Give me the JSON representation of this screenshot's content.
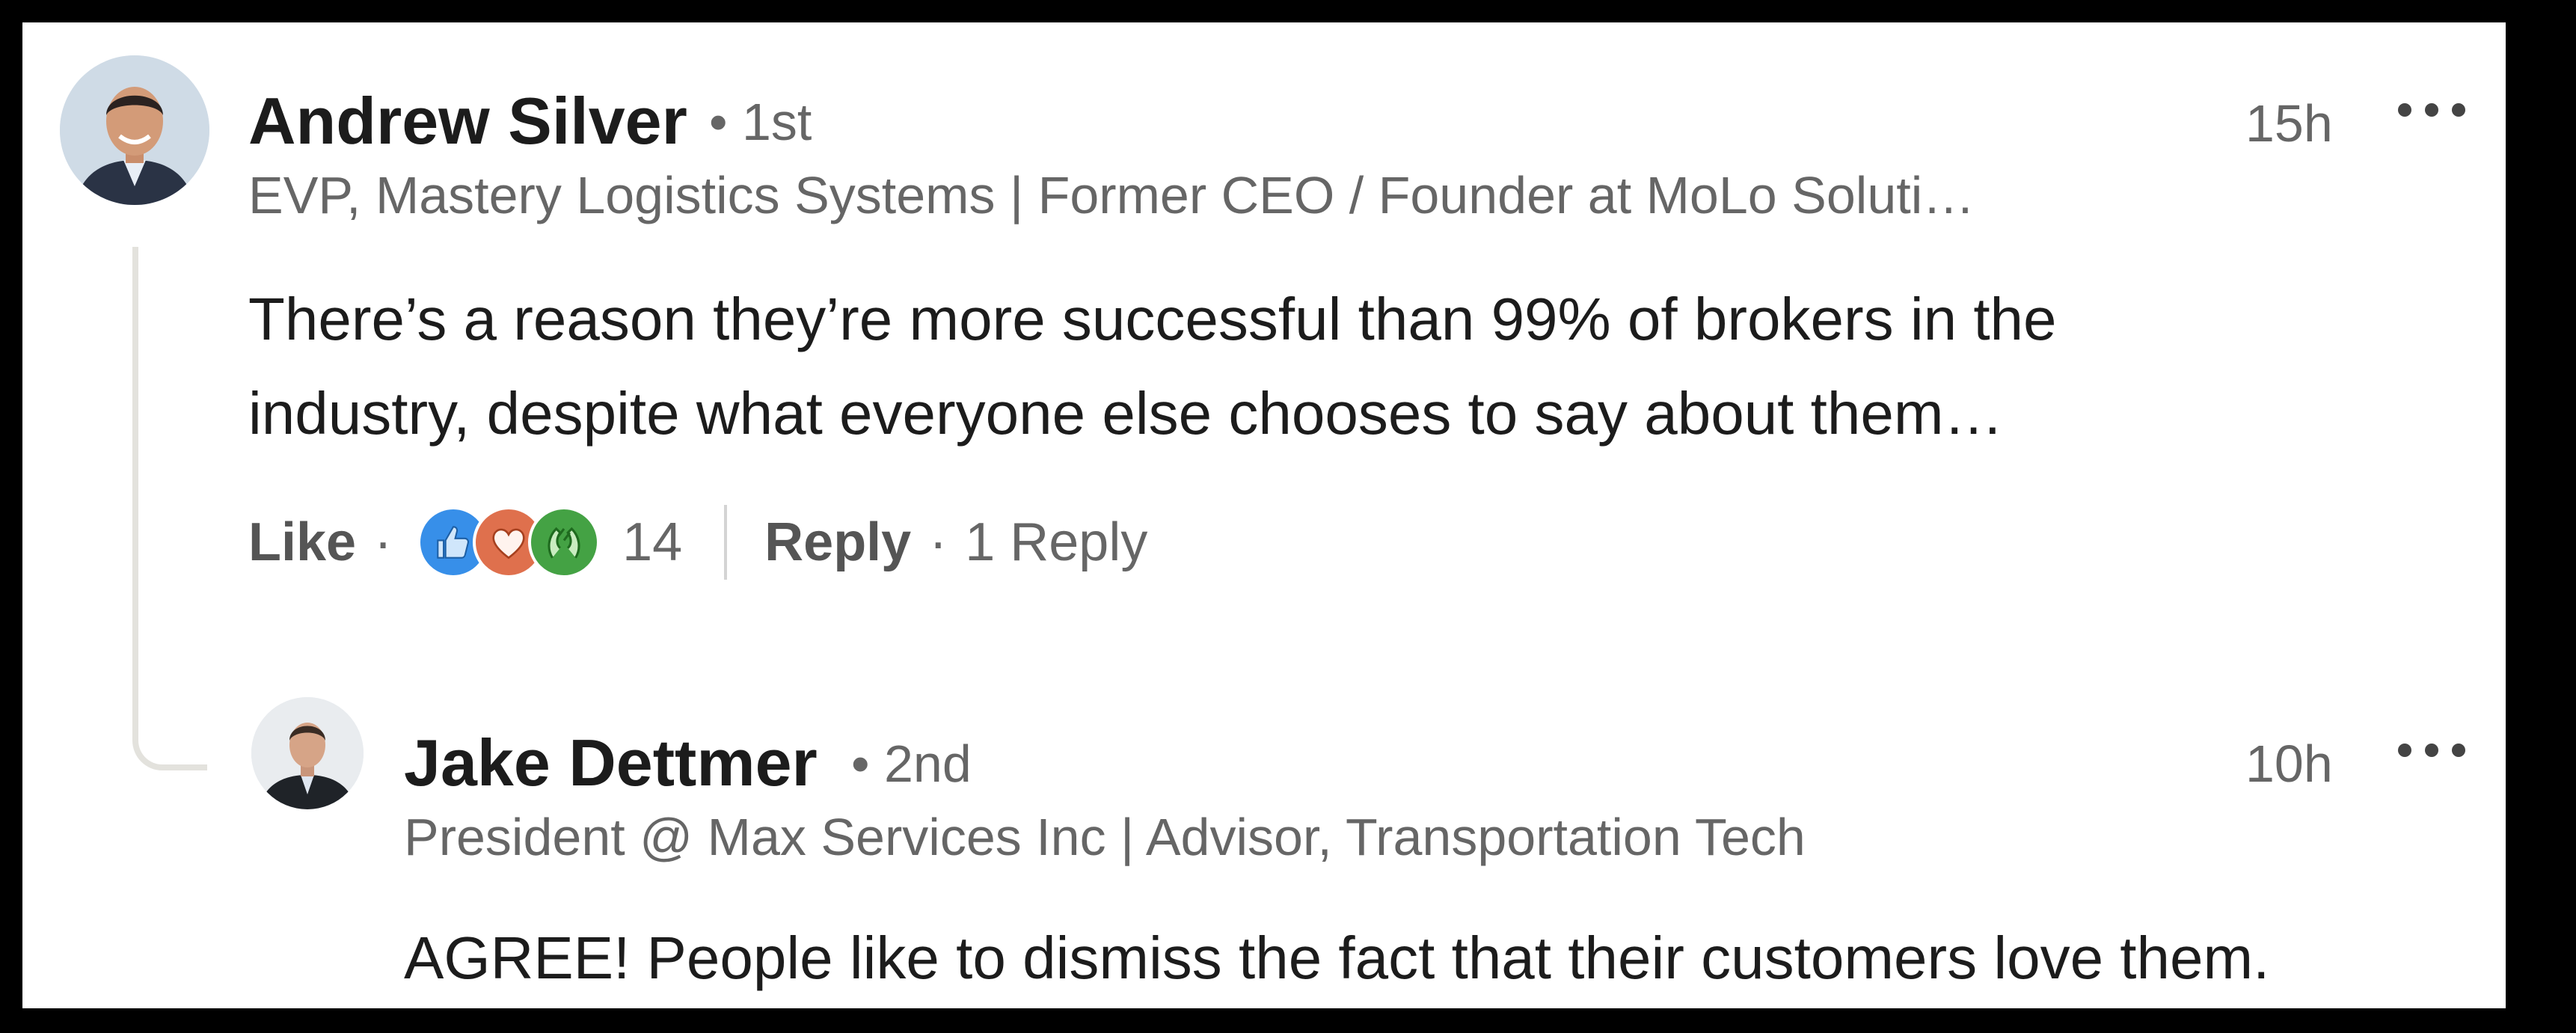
{
  "comment": {
    "author": "Andrew Silver",
    "degree": "• 1st",
    "headline": "EVP, Mastery Logistics Systems | Former CEO / Founder at MoLo Soluti…",
    "time": "15h",
    "text_lines": [
      "There’s a reason they’re more successful than 99% of brokers in the",
      "industry, despite what everyone else chooses to say about them…"
    ],
    "actions": {
      "like_label": "Like",
      "separator": "·",
      "reaction_count": "14",
      "reply_label": "Reply",
      "reply_count": "1 Reply"
    },
    "reaction_icons": [
      "like-reaction-icon",
      "love-reaction-icon",
      "celebrate-reaction-icon"
    ],
    "colors": {
      "like": "#378fe9",
      "love": "#df704d",
      "celebrate": "#44a244"
    }
  },
  "reply": {
    "author": "Jake Dettmer",
    "degree": "• 2nd",
    "headline": "President @ Max Services Inc | Advisor, Transportation Tech",
    "time": "10h",
    "text": "AGREE! People like to dismiss the fact that their customers love them."
  },
  "icons": {
    "more": "more-options-icon"
  }
}
